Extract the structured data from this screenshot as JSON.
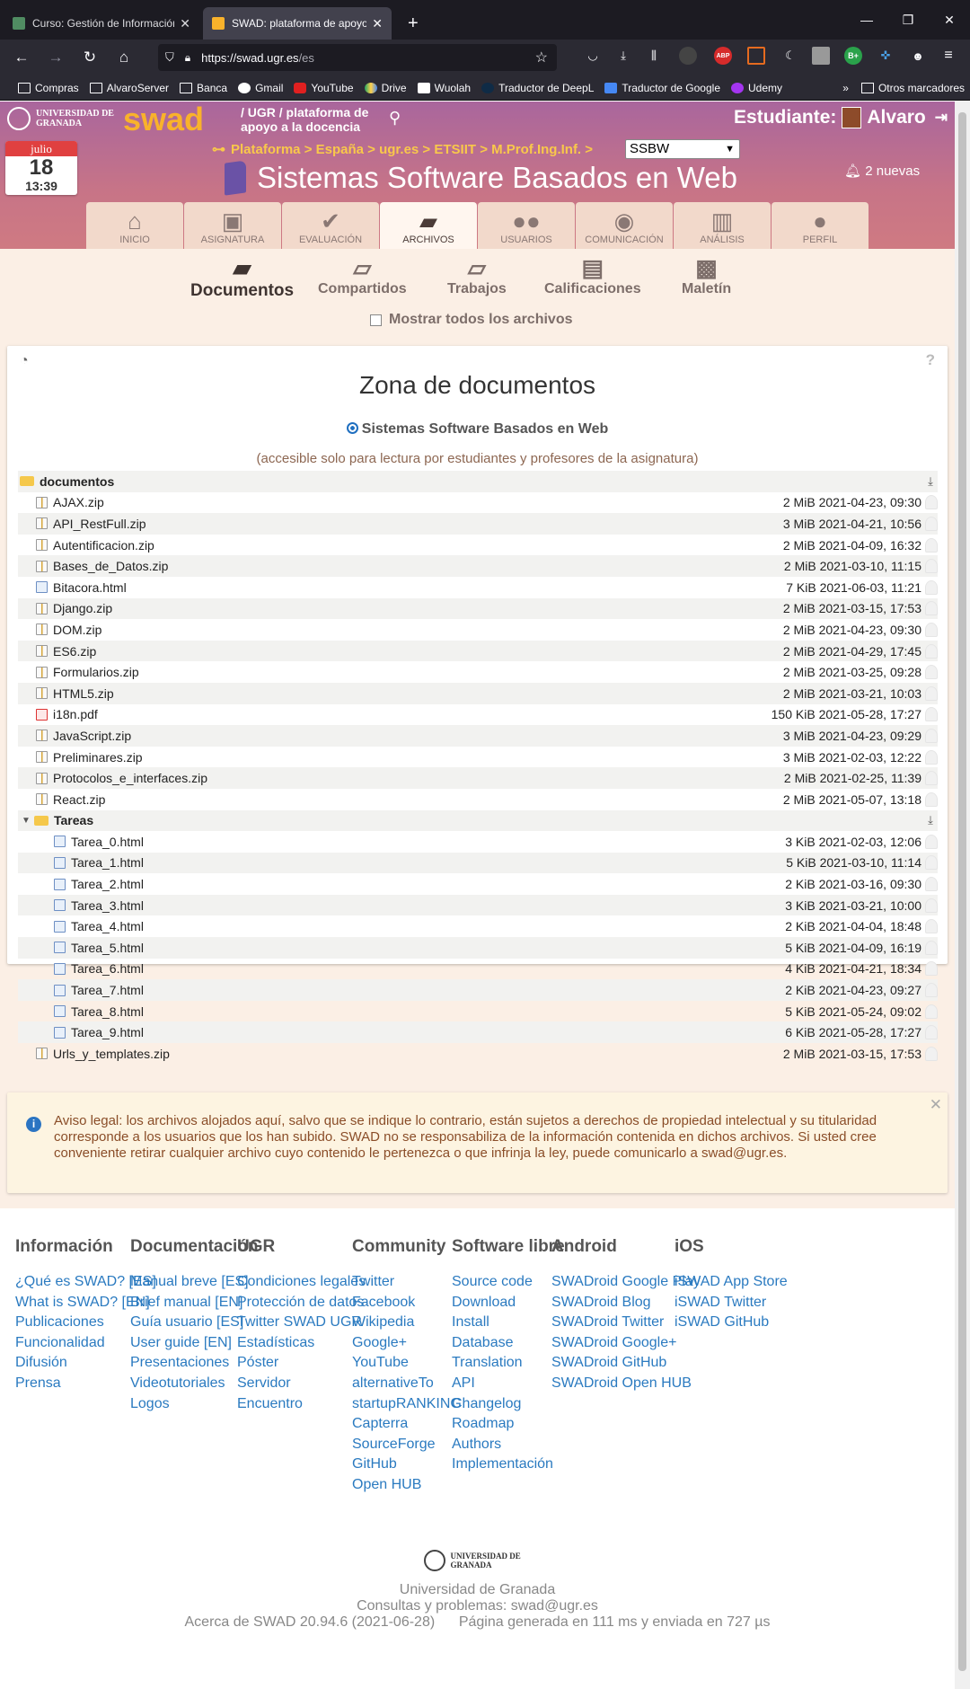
{
  "browser": {
    "tabs": [
      {
        "title": "Curso: Gestión de Información en la W",
        "active": false
      },
      {
        "title": "SWAD: plataforma de apoyo a la docencia",
        "active": true
      }
    ],
    "url_host": "https://swad.ugr.es",
    "url_path": "/es",
    "bookmarks": [
      "Compras",
      "AlvaroServer",
      "Banca",
      "Gmail",
      "YouTube",
      "Drive",
      "Wuolah",
      "Traductor de DeepL",
      "Traductor de Google",
      "Udemy"
    ],
    "other_bookmarks": "Otros marcadores",
    "ext_abp": "ABP",
    "ext_bplus": "B+"
  },
  "header": {
    "institution": "UNIVERSIDAD DE GRANADA",
    "logo_text": "swad",
    "tagline_line1": "/ UGR / plataforma de",
    "tagline_line2": "apoyo a la docencia",
    "role_label": "Estudiante:",
    "user_name": "Alvaro",
    "date_month": "julio",
    "date_day": "18",
    "date_time": "13:39",
    "breadcrumb": "Plataforma > España > ugr.es > ETSIIT > M.Prof.Ing.Inf. >",
    "course_select": "SSBW",
    "course_title": "Sistemas Software Basados en Web",
    "notifications": "2 nuevas"
  },
  "menu_tabs": [
    {
      "label": "INICIO",
      "icon": "home-icon",
      "glyph": "⌂"
    },
    {
      "label": "ASIGNATURA",
      "icon": "presentation-icon",
      "glyph": "▣"
    },
    {
      "label": "EVALUACIÓN",
      "icon": "check-icon",
      "glyph": "✔"
    },
    {
      "label": "ARCHIVOS",
      "icon": "folder-open-icon",
      "glyph": "▰"
    },
    {
      "label": "USUARIOS",
      "icon": "users-icon",
      "glyph": "●●"
    },
    {
      "label": "COMUNICACIÓN",
      "icon": "chat-icon",
      "glyph": "◉"
    },
    {
      "label": "ANÁLISIS",
      "icon": "bar-chart-icon",
      "glyph": "▥"
    },
    {
      "label": "PERFIL",
      "icon": "user-icon",
      "glyph": "●"
    }
  ],
  "sub_tabs": [
    {
      "label": "Documentos",
      "active": true
    },
    {
      "label": "Compartidos",
      "active": false
    },
    {
      "label": "Trabajos",
      "active": false
    },
    {
      "label": "Calificaciones",
      "active": false
    },
    {
      "label": "Maletín",
      "active": false
    }
  ],
  "show_all_label": "Mostrar todos los archivos",
  "documents": {
    "title": "Zona de documentos",
    "scope": "Sistemas Software Basados en Web",
    "access_note": "(accesible solo para lectura por estudiantes y profesores de la asignatura)",
    "root_folder": "documentos",
    "files_a": [
      {
        "name": "AJAX.zip",
        "type": "zip",
        "size": "2 MiB",
        "date": "2021-04-23, 09:30"
      },
      {
        "name": "API_RestFull.zip",
        "type": "zip",
        "size": "3 MiB",
        "date": "2021-04-21, 10:56"
      },
      {
        "name": "Autentificacion.zip",
        "type": "zip",
        "size": "2 MiB",
        "date": "2021-04-09, 16:32"
      },
      {
        "name": "Bases_de_Datos.zip",
        "type": "zip",
        "size": "2 MiB",
        "date": "2021-03-10, 11:15"
      },
      {
        "name": "Bitacora.html",
        "type": "html",
        "size": "7 KiB",
        "date": "2021-06-03, 11:21"
      },
      {
        "name": "Django.zip",
        "type": "zip",
        "size": "2 MiB",
        "date": "2021-03-15, 17:53"
      },
      {
        "name": "DOM.zip",
        "type": "zip",
        "size": "2 MiB",
        "date": "2021-04-23, 09:30"
      },
      {
        "name": "ES6.zip",
        "type": "zip",
        "size": "2 MiB",
        "date": "2021-04-29, 17:45"
      },
      {
        "name": "Formularios.zip",
        "type": "zip",
        "size": "2 MiB",
        "date": "2021-03-25, 09:28"
      },
      {
        "name": "HTML5.zip",
        "type": "zip",
        "size": "2 MiB",
        "date": "2021-03-21, 10:03"
      },
      {
        "name": "i18n.pdf",
        "type": "pdf",
        "size": "150 KiB",
        "date": "2021-05-28, 17:27"
      },
      {
        "name": "JavaScript.zip",
        "type": "zip",
        "size": "3 MiB",
        "date": "2021-04-23, 09:29"
      },
      {
        "name": "Preliminares.zip",
        "type": "zip",
        "size": "3 MiB",
        "date": "2021-02-03, 12:22"
      },
      {
        "name": "Protocolos_e_interfaces.zip",
        "type": "zip",
        "size": "2 MiB",
        "date": "2021-02-25, 11:39"
      },
      {
        "name": "React.zip",
        "type": "zip",
        "size": "2 MiB",
        "date": "2021-05-07, 13:18"
      }
    ],
    "subfolder": "Tareas",
    "subfolder_files": [
      {
        "name": "Tarea_0.html",
        "type": "html",
        "size": "3 KiB",
        "date": "2021-02-03, 12:06"
      },
      {
        "name": "Tarea_1.html",
        "type": "html",
        "size": "5 KiB",
        "date": "2021-03-10, 11:14"
      },
      {
        "name": "Tarea_2.html",
        "type": "html",
        "size": "2 KiB",
        "date": "2021-03-16, 09:30"
      },
      {
        "name": "Tarea_3.html",
        "type": "html",
        "size": "3 KiB",
        "date": "2021-03-21, 10:00"
      },
      {
        "name": "Tarea_4.html",
        "type": "html",
        "size": "2 KiB",
        "date": "2021-04-04, 18:48"
      },
      {
        "name": "Tarea_5.html",
        "type": "html",
        "size": "5 KiB",
        "date": "2021-04-09, 16:19"
      },
      {
        "name": "Tarea_6.html",
        "type": "html",
        "size": "4 KiB",
        "date": "2021-04-21, 18:34"
      },
      {
        "name": "Tarea_7.html",
        "type": "html",
        "size": "2 KiB",
        "date": "2021-04-23, 09:27"
      },
      {
        "name": "Tarea_8.html",
        "type": "html",
        "size": "5 KiB",
        "date": "2021-05-24, 09:02"
      },
      {
        "name": "Tarea_9.html",
        "type": "html",
        "size": "6 KiB",
        "date": "2021-05-28, 17:27"
      }
    ],
    "files_b": [
      {
        "name": "Urls_y_templates.zip",
        "type": "zip",
        "size": "2 MiB",
        "date": "2021-03-15, 17:53"
      }
    ]
  },
  "legal_notice": "Aviso legal: los archivos alojados aquí, salvo que se indique lo contrario, están sujetos a derechos de propiedad intelectual y su titularidad corresponde a los usuarios que los han subido. SWAD no se responsabiliza de la información contenida en dichos archivos. Si usted cree conveniente retirar cualquier archivo cuyo contenido le pertenezca o que infrinja la ley, puede comunicarlo a swad@ugr.es.",
  "footer": {
    "columns": [
      {
        "title": "Información",
        "links": [
          "¿Qué es SWAD? [ES]",
          "What is SWAD? [EN]",
          "Publicaciones",
          "Funcionalidad",
          "Difusión",
          "Prensa"
        ]
      },
      {
        "title": "Documentación",
        "links": [
          "Manual breve [ES]",
          "Brief manual [EN]",
          "Guía usuario [ES]",
          "User guide [EN]",
          "Presentaciones",
          "Videotutoriales",
          "Logos"
        ]
      },
      {
        "title": "UGR",
        "links": [
          "Condiciones legales",
          "Protección de datos",
          "Twitter SWAD UGR",
          "Estadísticas",
          "Póster",
          "Servidor",
          "Encuentro"
        ]
      },
      {
        "title": "Community",
        "links": [
          "Twitter",
          "Facebook",
          "Wikipedia",
          "Google+",
          "YouTube",
          "alternativeTo",
          "startupRANKING",
          "Capterra",
          "SourceForge",
          "GitHub",
          "Open HUB"
        ]
      },
      {
        "title": "Software libre",
        "links": [
          "Source code",
          "Download",
          "Install",
          "Database",
          "Translation",
          "API",
          "Changelog",
          "Roadmap",
          "Authors",
          "Implementación"
        ]
      },
      {
        "title": "Android",
        "links": [
          "SWADroid Google Play",
          "SWADroid Blog",
          "SWADroid Twitter",
          "SWADroid Google+",
          "SWADroid GitHub",
          "SWADroid Open HUB"
        ]
      },
      {
        "title": "iOS",
        "links": [
          "iSWAD App Store",
          "iSWAD Twitter",
          "iSWAD GitHub"
        ]
      }
    ],
    "institution": "UNIVERSIDAD DE GRANADA",
    "line1": "Universidad de Granada",
    "line2": "Consultas y problemas: swad@ugr.es",
    "line3": "Acerca de SWAD 20.94.6 (2021-06-28)      Página generada en 111 ms y enviada en 727 µs"
  }
}
